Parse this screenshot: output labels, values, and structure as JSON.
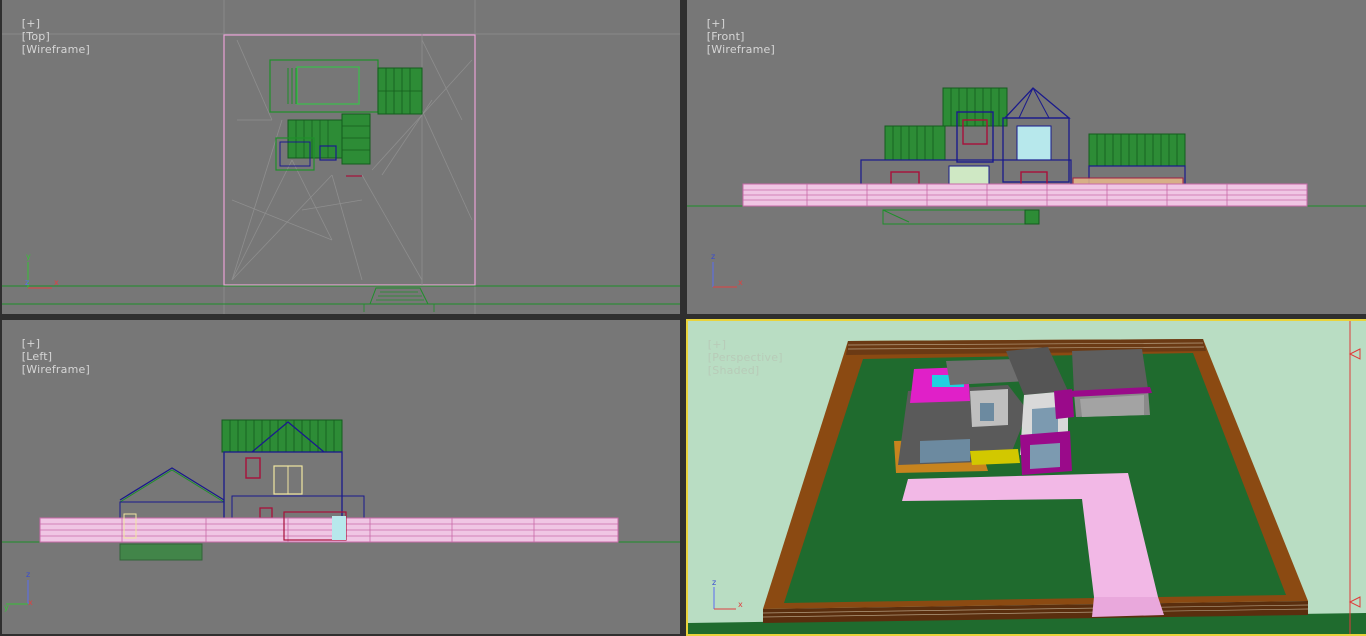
{
  "viewports": {
    "top": {
      "plus": "[+]",
      "name": "[Top]",
      "mode": "[Wireframe]"
    },
    "front": {
      "plus": "[+]",
      "name": "[Front]",
      "mode": "[Wireframe]"
    },
    "left": {
      "plus": "[+]",
      "name": "[Left]",
      "mode": "[Wireframe]"
    },
    "persp": {
      "plus": "[+]",
      "name": "[Perspective]",
      "mode": "[Shaded]"
    }
  },
  "axes": {
    "top": {
      "a": "y",
      "b": "x",
      "c": "z"
    },
    "front": {
      "a": "z",
      "b": "x"
    },
    "left": {
      "a": "z",
      "b": "x",
      "c": "y"
    },
    "persp": {
      "a": "z",
      "b": "x"
    }
  },
  "colors": {
    "viewport_bg": "#777777",
    "active_border": "#e9d33b",
    "wire_green": "#1e8f2a",
    "wire_pink": "#e9a2d6",
    "wire_blue": "#1a1a8c",
    "wire_red": "#a8103a",
    "lawn": "#1f6b2e",
    "path": "#f2b8e6",
    "fence": "#8b4a12"
  }
}
